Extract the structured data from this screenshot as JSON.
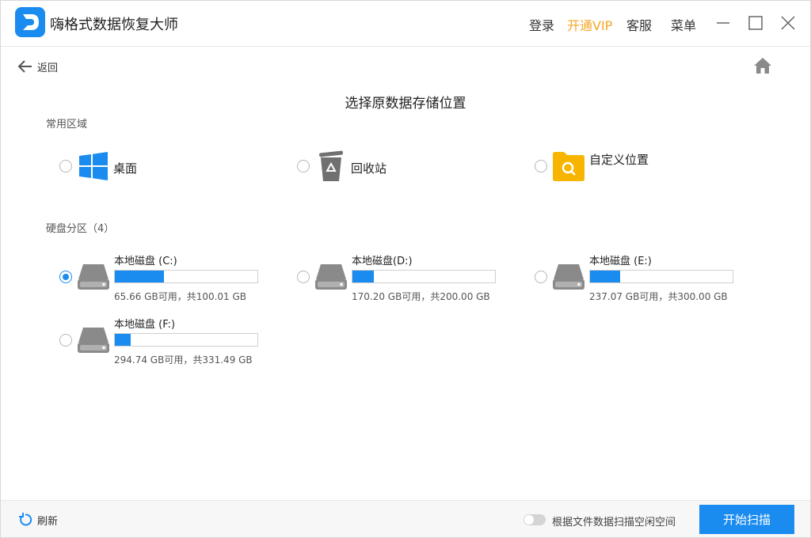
{
  "app": {
    "title": "嗨格式数据恢复大师"
  },
  "topbar": {
    "login": "登录",
    "vip": "开通VIP",
    "service": "客服",
    "menu": "菜单"
  },
  "nav": {
    "back": "返回"
  },
  "page_title": "选择原数据存储位置",
  "common": {
    "label": "常用区域",
    "items": [
      {
        "label": "桌面",
        "icon": "windows-icon",
        "selected": false
      },
      {
        "label": "回收站",
        "icon": "recycle-bin-icon",
        "selected": false
      },
      {
        "label": "自定义位置",
        "icon": "folder-search-icon",
        "selected": false
      }
    ]
  },
  "drives": {
    "label": "硬盘分区（4）",
    "items": [
      {
        "name": "本地磁盘 (C:)",
        "capacity": "65.66 GB可用，共100.01 GB",
        "used_fraction": 0.343,
        "selected": true
      },
      {
        "name": "本地磁盘(D:)",
        "capacity": "170.20 GB可用，共200.00 GB",
        "used_fraction": 0.149,
        "selected": false
      },
      {
        "name": "本地磁盘 (E:)",
        "capacity": "237.07 GB可用，共300.00 GB",
        "used_fraction": 0.21,
        "selected": false
      },
      {
        "name": "本地磁盘 (F:)",
        "capacity": "294.74 GB可用，共331.49 GB",
        "used_fraction": 0.111,
        "selected": false
      }
    ]
  },
  "footer": {
    "refresh": "刷新",
    "toggle_label": "根据文件数据扫描空闲空间",
    "toggle_on": false,
    "start": "开始扫描"
  },
  "colors": {
    "accent": "#1a8cf0",
    "vip": "#f5a623",
    "folder": "#f7b500",
    "drive": "#8a8a8a"
  }
}
